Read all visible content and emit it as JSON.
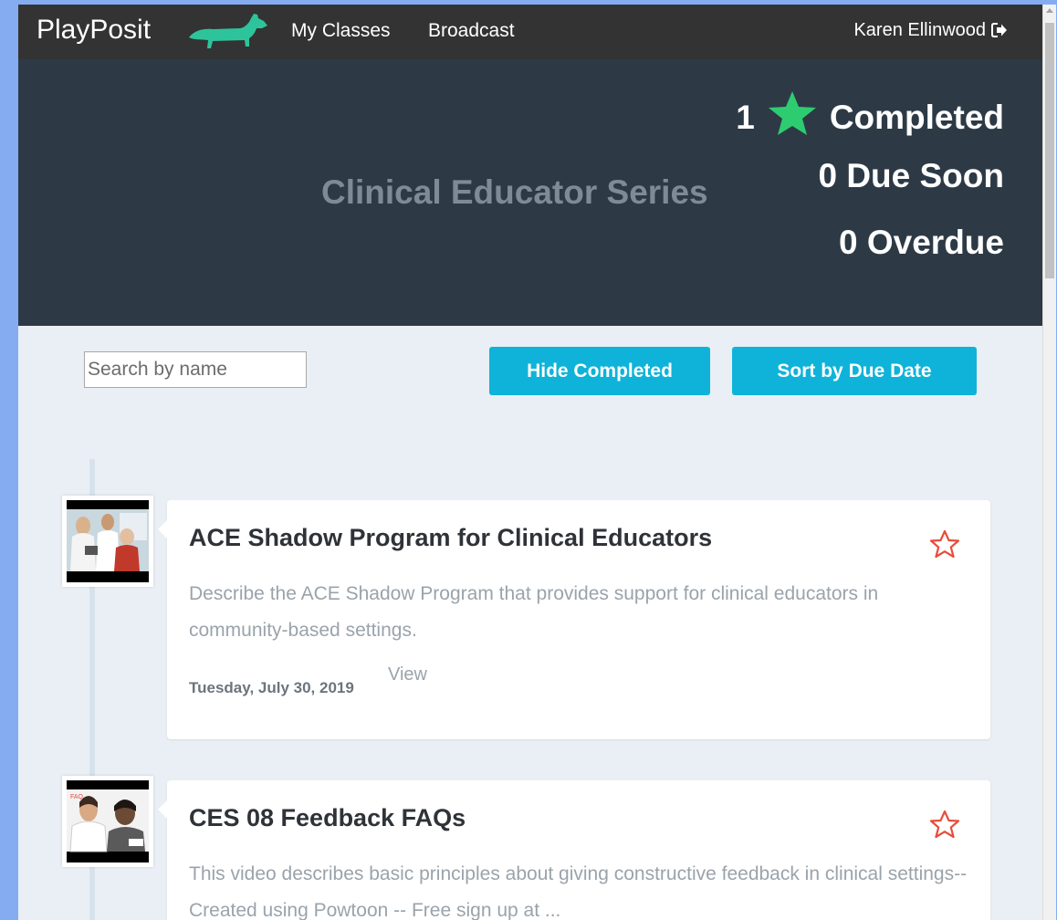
{
  "navbar": {
    "brand": "PlayPosit",
    "links": [
      "My Classes",
      "Broadcast"
    ],
    "user": "Karen Ellinwood"
  },
  "hero": {
    "class_title": "Clinical Educator Series",
    "completed_count": "1",
    "completed_label": "Completed",
    "due_soon": "0 Due Soon",
    "overdue": "0 Overdue"
  },
  "controls": {
    "search_placeholder": "Search by name",
    "hide_completed": "Hide Completed",
    "sort_due": "Sort by Due Date"
  },
  "bulbs": [
    {
      "title": "ACE Shadow Program for Clinical Educators",
      "description": "Describe the ACE Shadow Program that provides support for clinical educators in community-based settings.",
      "date": "Tuesday, July 30, 2019",
      "view": "View"
    },
    {
      "title": "CES 08 Feedback FAQs",
      "description": "This video describes basic principles about giving constructive feedback in clinical settings-- Created using Powtoon -- Free sign up at ..."
    }
  ],
  "colors": {
    "navbar": "#333333",
    "hero": "#2d3a46",
    "accent_button": "#0fb3d9",
    "completed_star": "#2ecc71",
    "favorite_star": "#e74c3c",
    "brand_dog": "#2ec49b"
  },
  "icons": {
    "brand": "dachshund-logo-icon",
    "user": "sign-out-icon",
    "completed": "star-filled-icon",
    "favorite": "star-outline-icon"
  }
}
